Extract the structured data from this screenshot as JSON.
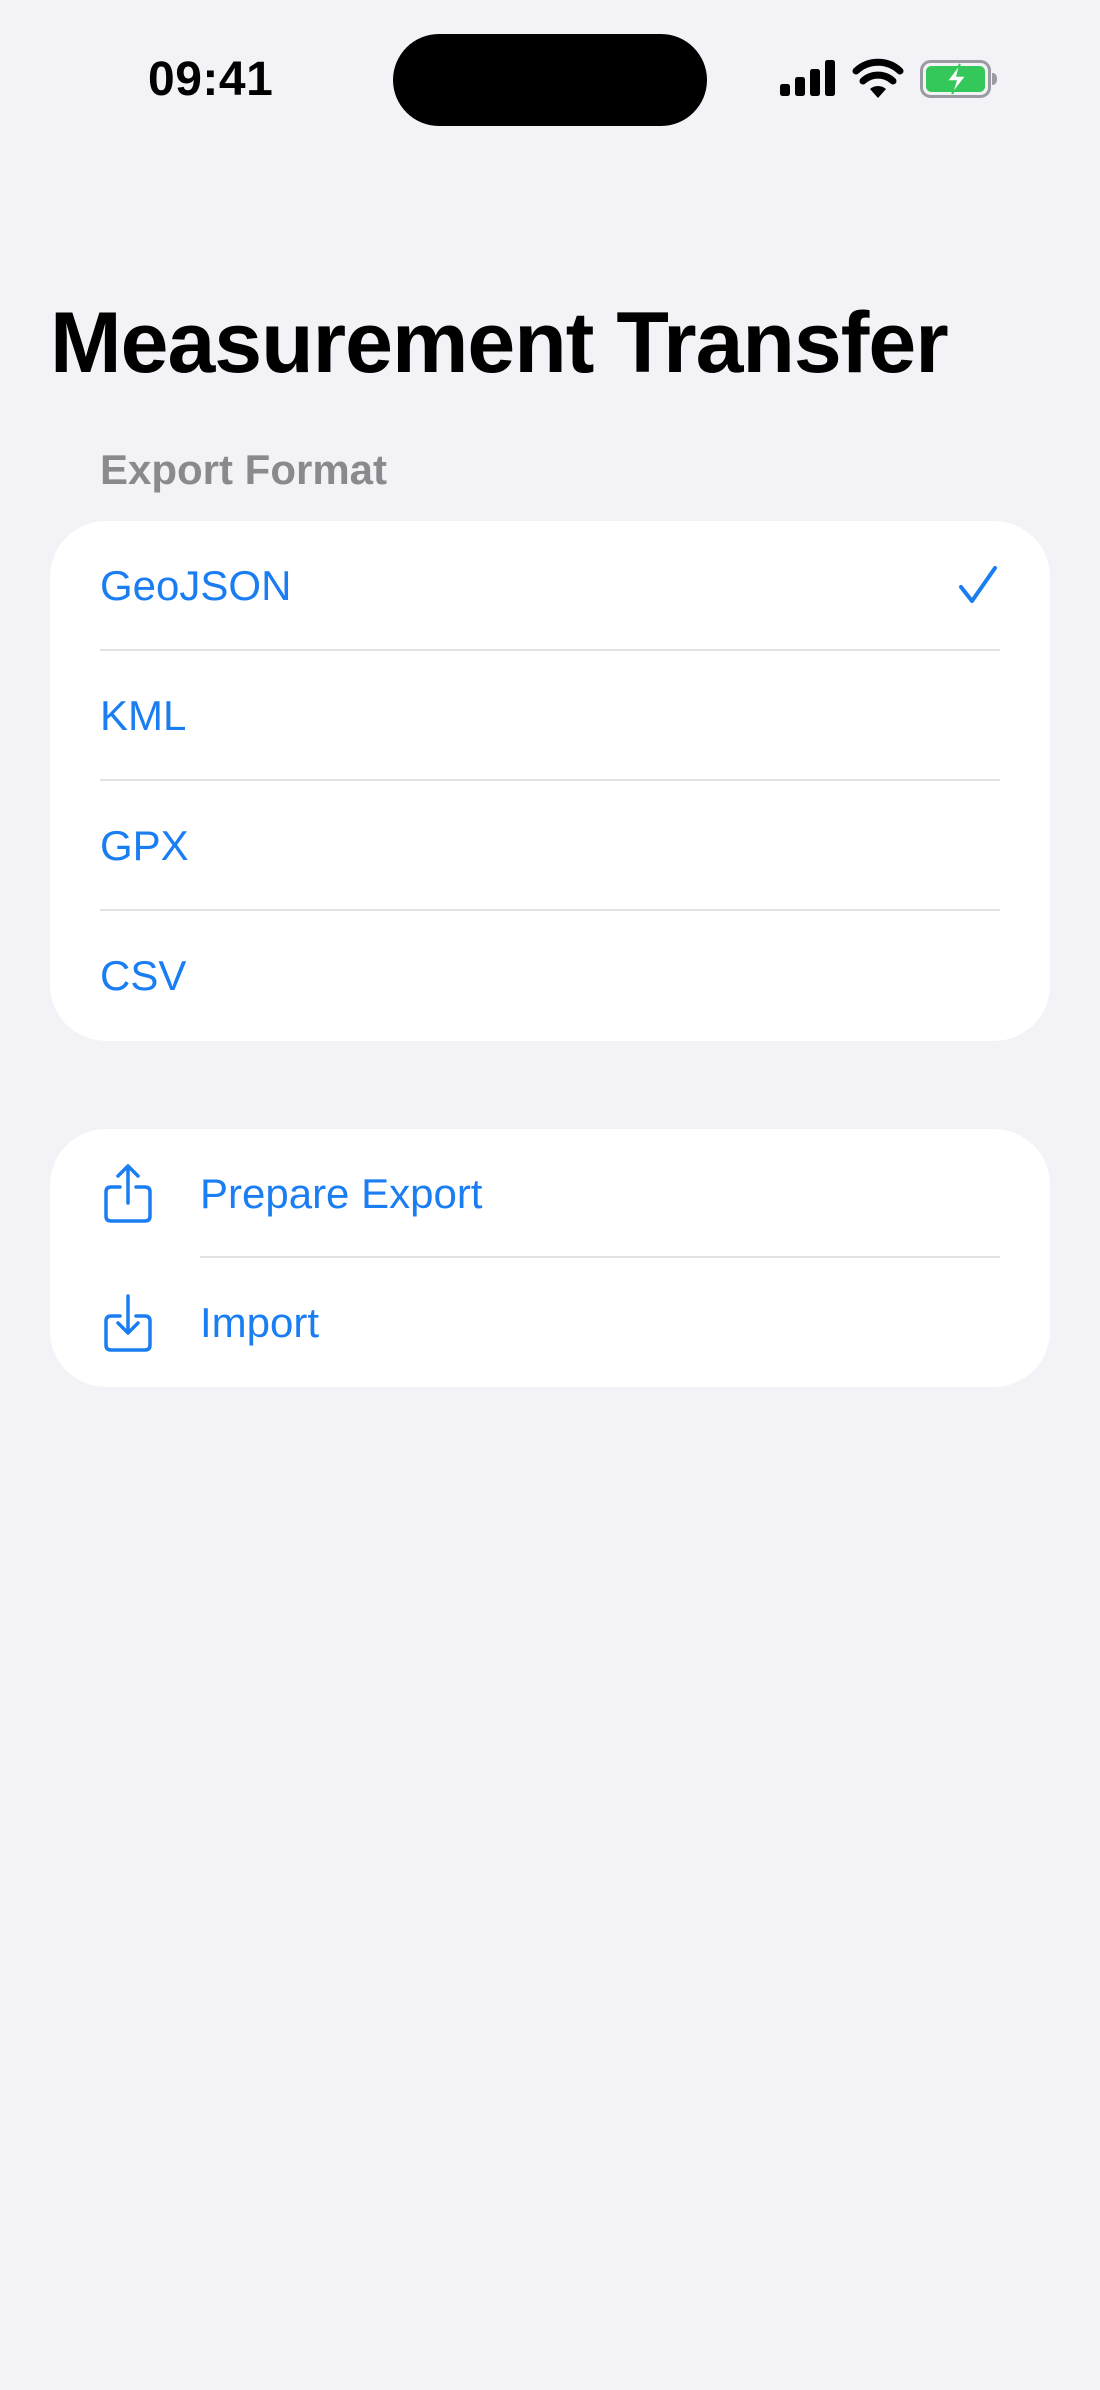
{
  "status_bar": {
    "time": "09:41"
  },
  "header": {
    "title": "Measurement Transfer"
  },
  "export_format": {
    "section_title": "Export Format",
    "options": [
      {
        "label": "GeoJSON",
        "selected": true
      },
      {
        "label": "KML",
        "selected": false
      },
      {
        "label": "GPX",
        "selected": false
      },
      {
        "label": "CSV",
        "selected": false
      }
    ]
  },
  "actions": [
    {
      "label": "Prepare Export",
      "icon": "share-icon"
    },
    {
      "label": "Import",
      "icon": "import-icon"
    }
  ],
  "colors": {
    "accent": "#1a7ef2",
    "background": "#f2f2f7",
    "secondary_text": "#8a8a8e",
    "battery_green": "#34c759"
  }
}
